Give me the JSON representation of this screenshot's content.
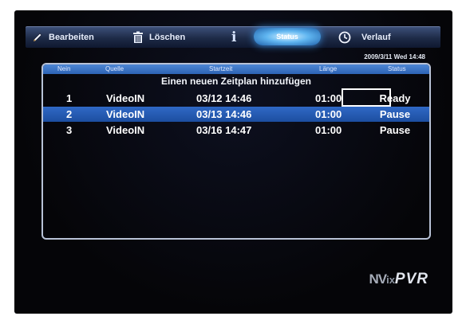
{
  "toolbar": {
    "edit_label": "Bearbeiten",
    "delete_label": "Löschen",
    "info_glyph": "i",
    "status_label": "Status",
    "history_label": "Verlauf"
  },
  "datetime": "2009/3/11 Wed 14:48",
  "table": {
    "headers": {
      "num": "Nein",
      "source": "Quelle",
      "start": "Startzeit",
      "length": "Länge",
      "status": "Status"
    },
    "add_row_label": "Einen neuen Zeitplan hinzufügen",
    "rows": [
      {
        "num": "1",
        "source": "VideoIN",
        "start": "03/12 14:46",
        "length": "01:00",
        "status": "Ready"
      },
      {
        "num": "2",
        "source": "VideoIN",
        "start": "03/13 14:46",
        "length": "01:00",
        "status": "Pause"
      },
      {
        "num": "3",
        "source": "VideoIN",
        "start": "03/16 14:47",
        "length": "01:00",
        "status": "Pause"
      }
    ],
    "selected_row": 2,
    "focused_cell": "row 3 status"
  },
  "logo": {
    "part1": "NV",
    "part2": "ix",
    "part3": "PVR"
  },
  "colors": {
    "toolbar_bg": "#1d2a46",
    "highlight": "#2d63b4",
    "status_glow": "#5fb5f0",
    "screen_bg": "#050508"
  },
  "icons": [
    "pencil-icon",
    "trash-icon",
    "info-icon",
    "clock-icon"
  ]
}
